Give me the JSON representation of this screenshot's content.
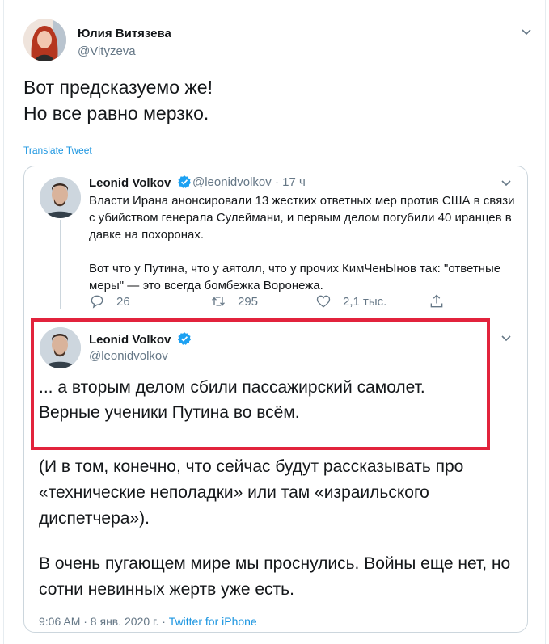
{
  "outer_tweet": {
    "author_name": "Юлия Витязева",
    "author_handle": "@Vityzeva",
    "text_line1": "Вот предсказуемо же!",
    "text_line2": "Но все равно мерзко.",
    "translate_label": "Translate Tweet"
  },
  "quoted_tweet_1": {
    "author_name": "Leonid Volkov",
    "author_handle": "@leonidvolkov",
    "separator": "·",
    "time_ago": "17 ч",
    "paragraph1": "Власти Ирана анонсировали 13 жестких ответных мер против США в связи с убийством генерала Сулеймани, и первым делом погубили 40 иранцев в давке на похоронах.",
    "paragraph2": "Вот что у Путина, что у аятолл, что у прочих КимЧенЫнов так: \"ответные меры\" — это всегда бомбежка Воронежа.",
    "replies": "26",
    "retweets": "295",
    "likes": "2,1 тыс."
  },
  "quoted_tweet_2": {
    "author_name": "Leonid Volkov",
    "author_handle": "@leonidvolkov",
    "line1": "... а вторым делом сбили пассажирский самолет.",
    "line2": "Верные ученики Путина во всём.",
    "paragraph2": "(И в том, конечно, что сейчас будут рассказывать про «технические неполадки» или там «израильского диспетчера»).",
    "paragraph3": "В очень пугающем мире мы проснулись. Войны еще нет, но сотни невинных жертв уже есть.",
    "timestamp": "9:06 AM · 8 янв. 2020 г. · ",
    "source": "Twitter for iPhone"
  },
  "colors": {
    "highlight_border": "#e2233c",
    "link_blue": "#1b95e0",
    "secondary_text": "#657786"
  }
}
